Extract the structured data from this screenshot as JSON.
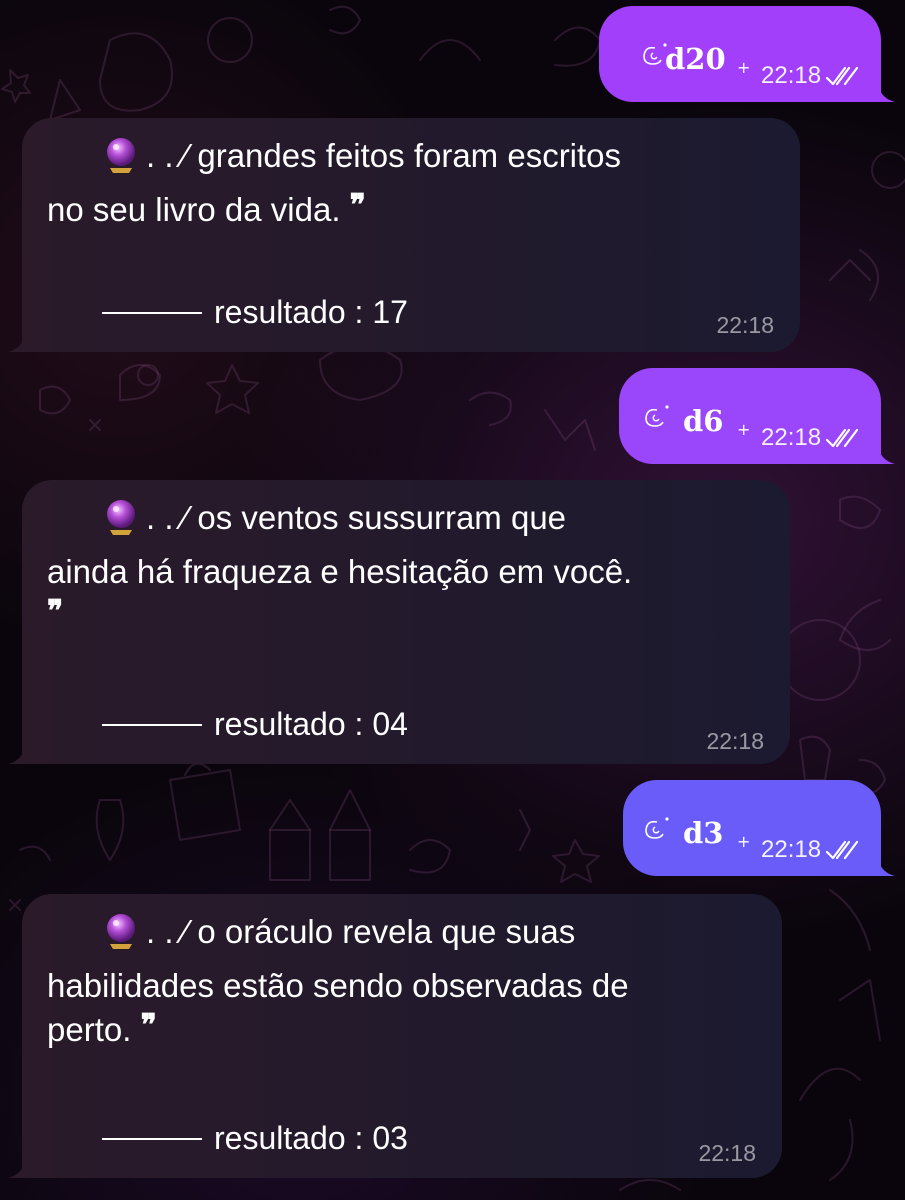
{
  "messages": [
    {
      "type": "outgoing",
      "command": "d20",
      "plus": "+",
      "time": "22:18",
      "status": "read",
      "color": "#a13ffb"
    },
    {
      "type": "incoming",
      "icon": "crystal-ball-icon",
      "lead": ". . ⁄ grandes feitos foram escritos",
      "rest": "no seu livro da vida. ",
      "quote": "❞",
      "result_label": "resultado : 17",
      "time": "22:18"
    },
    {
      "type": "outgoing",
      "command": "d6",
      "plus": "+",
      "time": "22:18",
      "status": "read",
      "color": "#9a46fb"
    },
    {
      "type": "incoming",
      "icon": "crystal-ball-icon",
      "lead": ". . ⁄ os ventos sussurram que",
      "rest": "ainda há fraqueza e hesitação em você.\n",
      "quote": "❞",
      "result_label": "resultado : 04",
      "time": "22:18"
    },
    {
      "type": "outgoing",
      "command": "d3",
      "plus": "+",
      "time": "22:18",
      "status": "read",
      "color": "#6a5cf8"
    },
    {
      "type": "incoming",
      "icon": "crystal-ball-icon",
      "lead": ". . ⁄ o oráculo revela que suas",
      "rest": "habilidades estão sendo observadas de\nperto. ",
      "quote": "❞",
      "result_label": "resultado : 03",
      "time": "22:18"
    }
  ],
  "colors": {
    "outgoing_1": "#a13ffb",
    "outgoing_2": "#9a46fb",
    "outgoing_3": "#6a5cf8",
    "incoming_start": "#2a1a2a",
    "incoming_end": "#1c1a30"
  }
}
